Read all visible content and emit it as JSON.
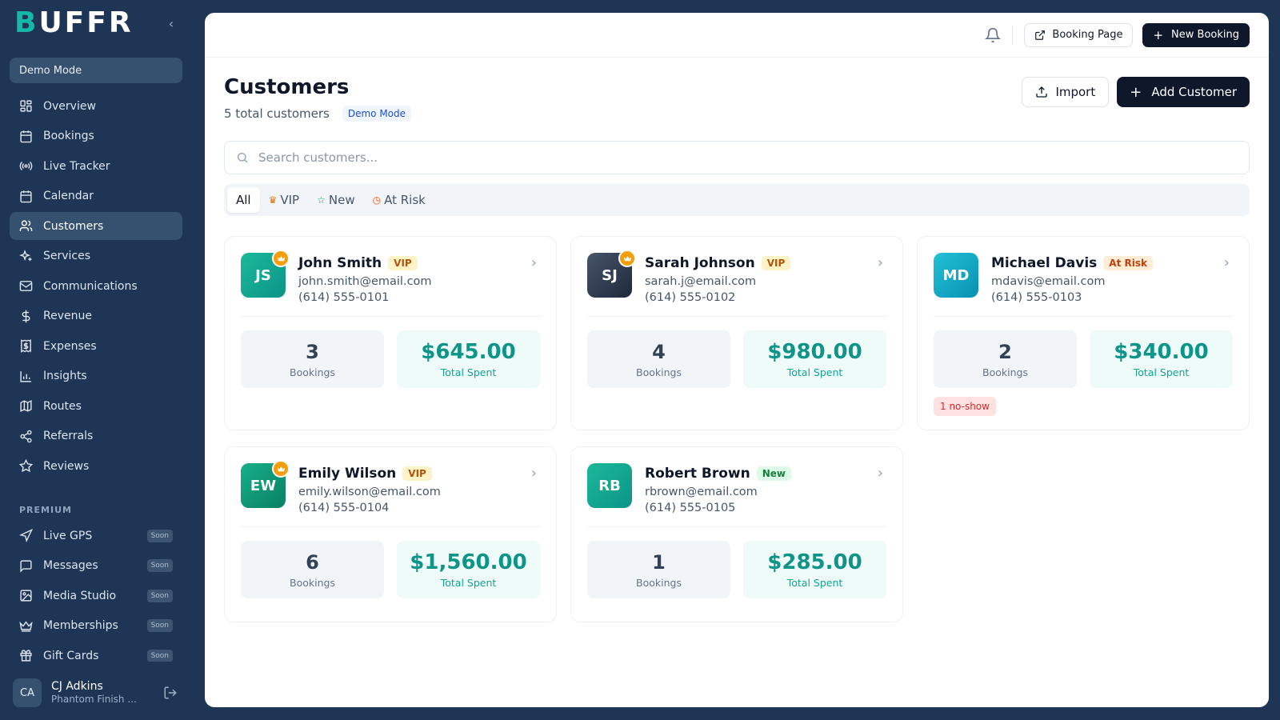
{
  "sidebar": {
    "logo": {
      "initial": "B",
      "rest": "UFFR"
    },
    "demo_mode": "Demo Mode",
    "items": [
      {
        "label": "Overview",
        "icon": "grid-icon"
      },
      {
        "label": "Bookings",
        "icon": "calendar-check-icon"
      },
      {
        "label": "Live Tracker",
        "icon": "radio-icon"
      },
      {
        "label": "Calendar",
        "icon": "calendar-icon"
      },
      {
        "label": "Customers",
        "icon": "users-icon",
        "active": true
      },
      {
        "label": "Services",
        "icon": "sparkles-icon"
      },
      {
        "label": "Communications",
        "icon": "mail-icon"
      },
      {
        "label": "Revenue",
        "icon": "dollar-icon"
      },
      {
        "label": "Expenses",
        "icon": "receipt-icon"
      },
      {
        "label": "Insights",
        "icon": "bar-chart-icon"
      },
      {
        "label": "Routes",
        "icon": "map-icon"
      },
      {
        "label": "Referrals",
        "icon": "share-icon"
      },
      {
        "label": "Reviews",
        "icon": "star-icon"
      }
    ],
    "premium_heading": "PREMIUM",
    "premium_items": [
      {
        "label": "Live GPS",
        "icon": "navigation-icon",
        "tag": "Soon"
      },
      {
        "label": "Messages",
        "icon": "message-icon",
        "tag": "Soon"
      },
      {
        "label": "Media Studio",
        "icon": "image-icon",
        "tag": "Soon"
      },
      {
        "label": "Memberships",
        "icon": "crown-icon",
        "tag": "Soon"
      },
      {
        "label": "Gift Cards",
        "icon": "gift-icon",
        "tag": "Soon"
      }
    ],
    "user": {
      "initials": "CA",
      "name": "CJ Adkins",
      "org": "Phantom Finish ..."
    }
  },
  "topbar": {
    "booking_page": "Booking Page",
    "new_booking": "New Booking"
  },
  "page": {
    "title": "Customers",
    "count": "5 total customers",
    "demo_badge": "Demo Mode",
    "import": "Import",
    "add_customer": "Add Customer",
    "search_placeholder": "Search customers..."
  },
  "tabs": [
    {
      "label": "All",
      "icon": "",
      "active": true
    },
    {
      "label": "VIP",
      "icon": "crown-icon"
    },
    {
      "label": "New",
      "icon": "star-icon"
    },
    {
      "label": "At Risk",
      "icon": "clock-icon"
    }
  ],
  "customers": [
    {
      "initials": "JS",
      "name": "John Smith",
      "badge": "VIP",
      "email": "john.smith@email.com",
      "phone": "(614) 555-0101",
      "bookings": "3",
      "bookings_label": "Bookings",
      "spent": "$645.00",
      "spent_label": "Total Spent",
      "crown": true,
      "color": "#14a58e"
    },
    {
      "initials": "SJ",
      "name": "Sarah Johnson",
      "badge": "VIP",
      "email": "sarah.j@email.com",
      "phone": "(614) 555-0102",
      "bookings": "4",
      "bookings_label": "Bookings",
      "spent": "$980.00",
      "spent_label": "Total Spent",
      "crown": true,
      "color": "#334155"
    },
    {
      "initials": "MD",
      "name": "Michael Davis",
      "badge": "At Risk",
      "email": "mdavis@email.com",
      "phone": "(614) 555-0103",
      "bookings": "2",
      "bookings_label": "Bookings",
      "spent": "$340.00",
      "spent_label": "Total Spent",
      "crown": false,
      "color": "#0ea5b7",
      "flag": "1 no-show"
    },
    {
      "initials": "EW",
      "name": "Emily Wilson",
      "badge": "VIP",
      "email": "emily.wilson@email.com",
      "phone": "(614) 555-0104",
      "bookings": "6",
      "bookings_label": "Bookings",
      "spent": "$1,560.00",
      "spent_label": "Total Spent",
      "crown": true,
      "color": "#0f9b78"
    },
    {
      "initials": "RB",
      "name": "Robert Brown",
      "badge": "New",
      "email": "rbrown@email.com",
      "phone": "(614) 555-0105",
      "bookings": "1",
      "bookings_label": "Bookings",
      "spent": "$285.00",
      "spent_label": "Total Spent",
      "crown": false,
      "color": "#14a58e"
    }
  ]
}
